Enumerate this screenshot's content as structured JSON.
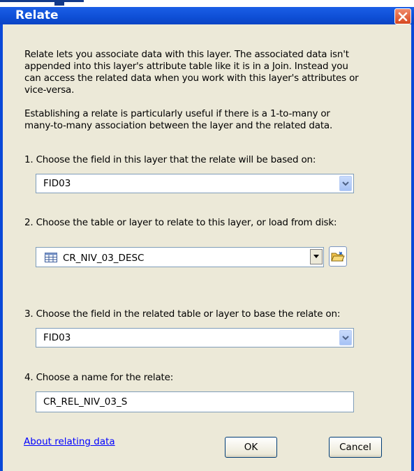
{
  "window": {
    "title": "Relate",
    "close_icon": "close-icon"
  },
  "intro": {
    "line1": "Relate lets you associate data with this layer. The associated data isn't",
    "line2": "appended into this layer's attribute table like it is in a Join. Instead you",
    "line3": "can access the related data when you work with this layer's attributes or",
    "line4": "vice-versa."
  },
  "establish": {
    "line1": "Establishing a relate is particularly useful if there is a 1-to-many or",
    "line2": "many-to-many association between the layer and the related data."
  },
  "step1": {
    "label": "1. Choose the field in this layer that the relate will be based on:",
    "value": "FID03"
  },
  "step2": {
    "label": "2. Choose the table or layer to relate to this layer, or load from disk:",
    "value": "CR_NIV_03_DESC",
    "table_icon": "table-icon",
    "browse_icon": "open-folder-icon"
  },
  "step3": {
    "label": "3. Choose the field in the related table or layer to base the relate on:",
    "value": "FID03"
  },
  "step4": {
    "label": "4. Choose a name for the relate:",
    "value": "CR_REL_NIV_03_S"
  },
  "footer": {
    "link": "About relating data",
    "ok": "OK",
    "cancel": "Cancel"
  },
  "colors": {
    "titlebar": "#0a49d8",
    "dialog_bg": "#ece9d8",
    "link": "#0000ff",
    "close": "#d6481f"
  }
}
